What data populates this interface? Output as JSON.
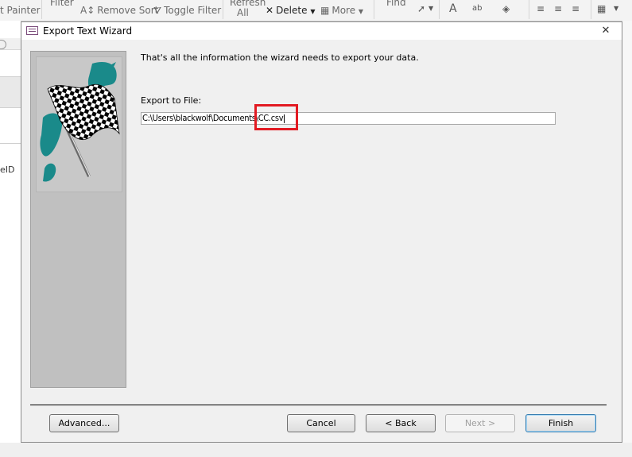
{
  "ribbon": {
    "painter_label": "t Painter",
    "filter_label": "Filter",
    "remove_sort_label": "Remove Sort",
    "toggle_filter_label": "Toggle Filter",
    "refresh_label": "Refresh",
    "refresh_all_label": "All",
    "delete_label": "Delete",
    "more_label": "More",
    "find_label": "Find"
  },
  "background": {
    "field_label": "eID"
  },
  "dialog": {
    "title": "Export Text Wizard",
    "close_glyph": "✕",
    "message": "That's all the information the wizard needs to export your data.",
    "export_label": "Export to File:",
    "path_prefix": "C:\\Users\\blackwolf\\Documents\\",
    "path_file": "CC.csv",
    "buttons": {
      "advanced": "Advanced...",
      "cancel": "Cancel",
      "back": "< Back",
      "next": "Next >",
      "finish": "Finish"
    }
  },
  "colors": {
    "highlight": "#e21a22",
    "flag_accent": "#1a8a8a"
  }
}
